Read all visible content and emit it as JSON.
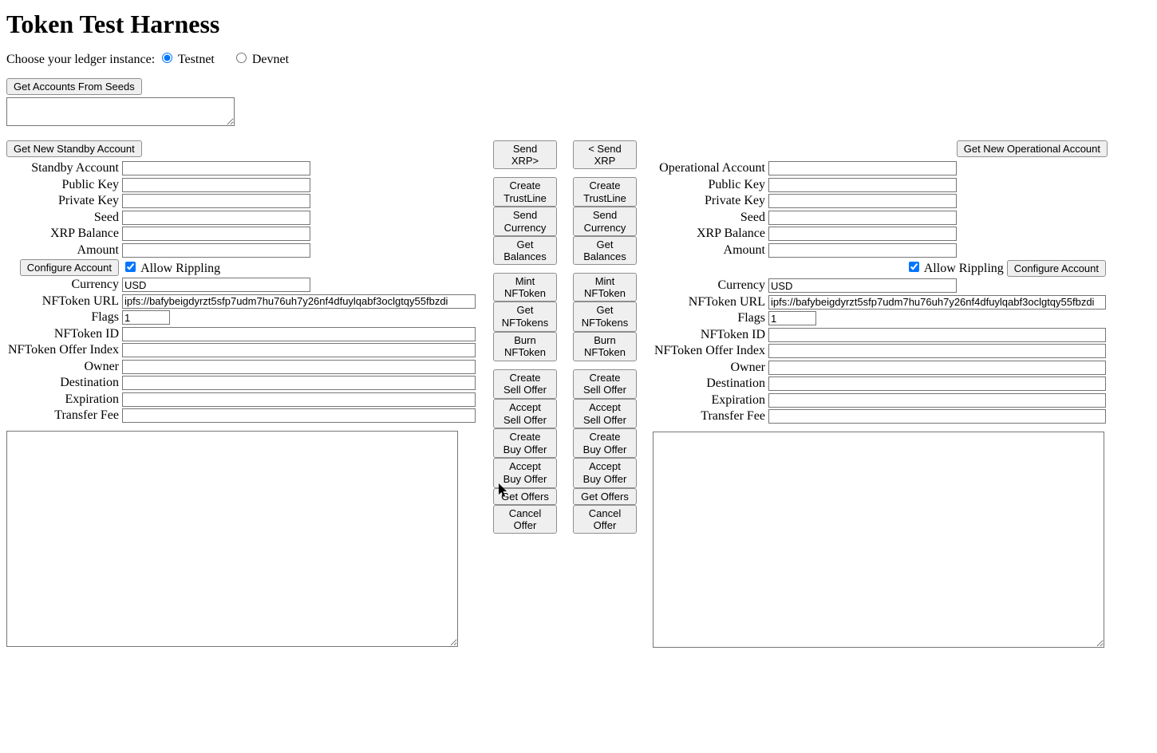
{
  "title": "Token Test Harness",
  "ledger": {
    "prompt": "Choose your ledger instance:",
    "testnet_label": "Testnet",
    "devnet_label": "Devnet",
    "selected": "testnet"
  },
  "seed_block": {
    "button": "Get Accounts From Seeds",
    "value": ""
  },
  "standby": {
    "new_account_btn": "Get New Standby Account",
    "labels": {
      "account": "Standby Account",
      "pubkey": "Public Key",
      "privkey": "Private Key",
      "seed": "Seed",
      "balance": "XRP Balance",
      "amount": "Amount",
      "configure": "Configure Account",
      "allow_rippling": "Allow Rippling",
      "currency": "Currency",
      "nft_url": "NFToken URL",
      "flags": "Flags",
      "nft_id": "NFToken ID",
      "nft_offer_index": "NFToken Offer Index",
      "owner": "Owner",
      "destination": "Destination",
      "expiration": "Expiration",
      "transfer_fee": "Transfer Fee"
    },
    "values": {
      "account": "",
      "pubkey": "",
      "privkey": "",
      "seed": "",
      "balance": "",
      "amount": "",
      "allow_rippling": true,
      "currency": "USD",
      "nft_url": "ipfs://bafybeigdyrzt5sfp7udm7hu76uh7y26nf4dfuylqabf3oclgtqy55fbzdi",
      "flags": "1",
      "nft_id": "",
      "nft_offer_index": "",
      "owner": "",
      "destination": "",
      "expiration": "",
      "transfer_fee": "",
      "log": ""
    }
  },
  "operational": {
    "new_account_btn": "Get New Operational Account",
    "labels": {
      "account": "Operational Account",
      "pubkey": "Public Key",
      "privkey": "Private Key",
      "seed": "Seed",
      "balance": "XRP Balance",
      "amount": "Amount",
      "configure": "Configure Account",
      "allow_rippling": "Allow Rippling",
      "currency": "Currency",
      "nft_url": "NFToken URL",
      "flags": "Flags",
      "nft_id": "NFToken ID",
      "nft_offer_index": "NFToken Offer Index",
      "owner": "Owner",
      "destination": "Destination",
      "expiration": "Expiration",
      "transfer_fee": "Transfer Fee"
    },
    "values": {
      "account": "",
      "pubkey": "",
      "privkey": "",
      "seed": "",
      "balance": "",
      "amount": "",
      "allow_rippling": true,
      "currency": "USD",
      "nft_url": "ipfs://bafybeigdyrzt5sfp7udm7hu76uh7y26nf4dfuylqabf3oclgtqy55fbzdi",
      "flags": "1",
      "nft_id": "",
      "nft_offer_index": "",
      "owner": "",
      "destination": "",
      "expiration": "",
      "transfer_fee": "",
      "log": ""
    }
  },
  "center": {
    "send_xrp_r": "Send XRP>",
    "send_xrp_l": "< Send XRP",
    "create_trustline": "Create TrustLine",
    "send_currency": "Send Currency",
    "get_balances": "Get Balances",
    "mint_nft": "Mint NFToken",
    "get_nfts": "Get NFTokens",
    "burn_nft": "Burn NFToken",
    "create_sell": "Create Sell Offer",
    "accept_sell": "Accept Sell Offer",
    "create_buy": "Create Buy Offer",
    "accept_buy": "Accept Buy Offer",
    "get_offers": "Get Offers",
    "cancel_offer": "Cancel Offer"
  }
}
